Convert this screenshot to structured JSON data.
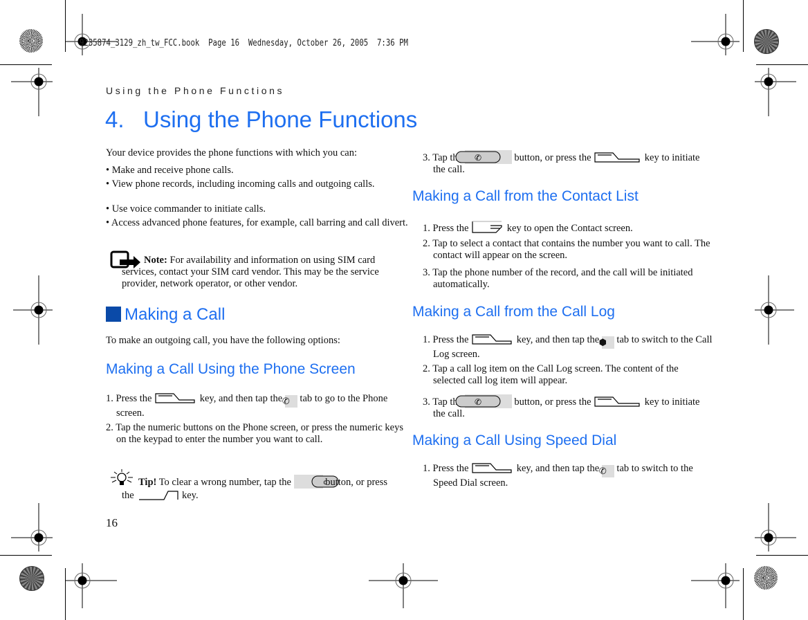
{
  "slug": "9235874_3129_zh_tw_FCC.book  Page 16  Wednesday, October 26, 2005  7:36 PM",
  "running_head": "Using the Phone Functions",
  "chapter_title": "4.   Using the Phone Functions",
  "intro": {
    "lead": "Your device provides the phone functions with which you can:",
    "bullets": [
      "• Make and receive phone calls.",
      "• View phone records, including incoming calls and outgoing calls.",
      "• Use voice commander to initiate calls.",
      "• Access advanced phone features, for example, call barring and call divert."
    ]
  },
  "note": {
    "label": "Note:",
    "text": " For availability and information on using SIM card services, contact your SIM card vendor. This may be the service provider, network operator, or other vendor."
  },
  "making_a_call": {
    "title": "Making a Call",
    "text": "To make an outgoing call, you have the following options:"
  },
  "phone_screen": {
    "title": "Making a Call Using the Phone Screen",
    "step1_a": "1. Press the ",
    "step1_b": " key, and then tap the ",
    "step1_c": " tab to go to the Phone screen.",
    "step2": "2. Tap the numeric buttons on the Phone screen, or press the numeric keys on the keypad to enter the number you want to call.",
    "tip_label": "Tip!",
    "tip_a": " To clear a wrong number, tap the ",
    "tip_b": " button, or press the ",
    "tip_c": " key.",
    "clear_button_label": "c",
    "step3_a": "3. Tap the ",
    "step3_b": " button, or press the ",
    "step3_c": " key to initiate the call."
  },
  "contact_list": {
    "title": "Making a Call from the Contact List",
    "step1_a": "1. Press the ",
    "step1_b": " key to open the Contact screen.",
    "step2": "2. Tap to select a contact that contains the number you want to call. The contact will appear on the screen.",
    "step3": "3. Tap the phone number of the record, and the call will be initiated automatically."
  },
  "call_log": {
    "title": "Making a Call from the Call Log",
    "step1_a": "1. Press the ",
    "step1_b": " key, and then tap the ",
    "step1_c": " tab to switch to the Call Log screen.",
    "step2": "2. Tap a call log item on the Call Log screen. The content of the selected call log item will appear.",
    "step3_a": "3. Tap the ",
    "step3_b": " button, or press the ",
    "step3_c": " key to initiate the call."
  },
  "speed_dial": {
    "title": "Making a Call Using Speed Dial",
    "step1_a": "1. Press the ",
    "step1_b": " key, and then tap the ",
    "step1_c": " tab to switch to the Speed Dial screen."
  },
  "page_number": "16",
  "colors": {
    "heading": "#1e6ff0",
    "section_square": "#0a4aa8"
  }
}
